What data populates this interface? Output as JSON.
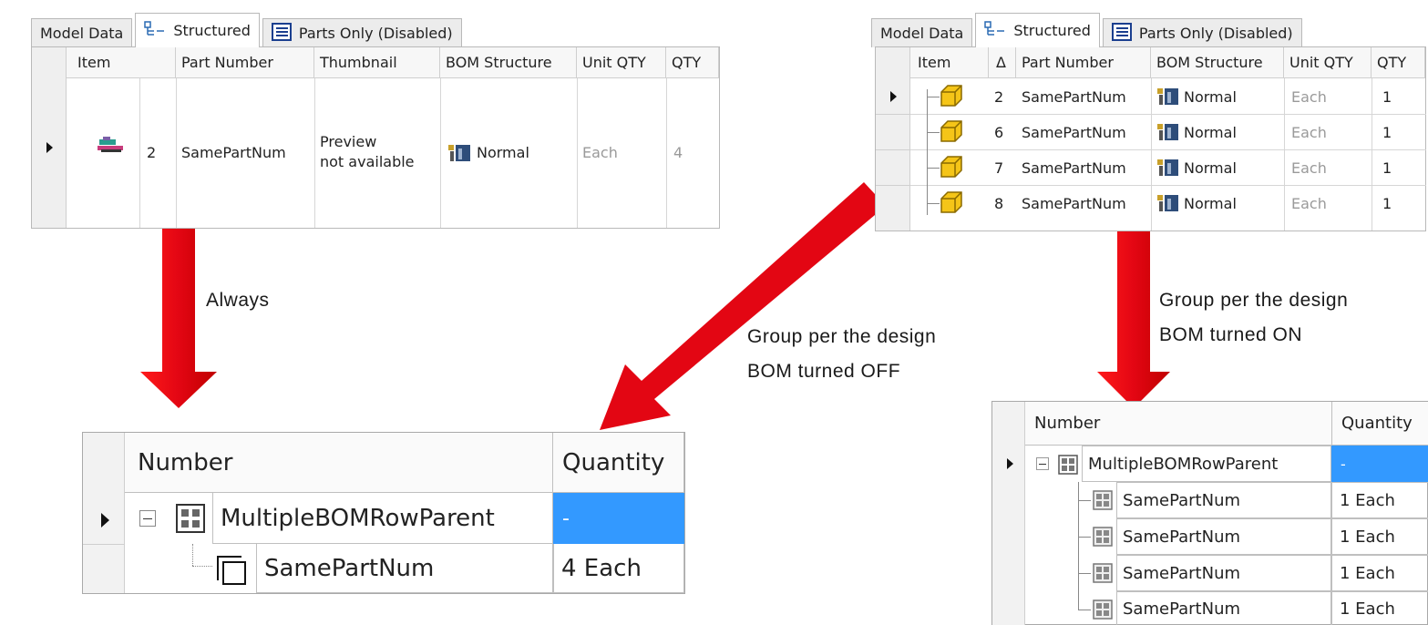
{
  "tabs": {
    "model_data": "Model Data",
    "structured": "Structured",
    "parts_only": "Parts Only (Disabled)"
  },
  "left_grid": {
    "headers": [
      "Item",
      "Part Number",
      "Thumbnail",
      "BOM Structure",
      "Unit QTY",
      "QTY"
    ],
    "row": {
      "item": "2",
      "part_number": "SamePartNum",
      "thumbnail_line1": "Preview",
      "thumbnail_line2": "not available",
      "bom_structure": "Normal",
      "unit_qty": "Each",
      "qty": "4"
    }
  },
  "right_grid": {
    "headers": [
      "Item",
      "Δ",
      "Part Number",
      "BOM Structure",
      "Unit QTY",
      "QTY"
    ],
    "rows": [
      {
        "item": "2",
        "part_number": "SamePartNum",
        "bom_structure": "Normal",
        "unit_qty": "Each",
        "qty": "1"
      },
      {
        "item": "6",
        "part_number": "SamePartNum",
        "bom_structure": "Normal",
        "unit_qty": "Each",
        "qty": "1"
      },
      {
        "item": "7",
        "part_number": "SamePartNum",
        "bom_structure": "Normal",
        "unit_qty": "Each",
        "qty": "1"
      },
      {
        "item": "8",
        "part_number": "SamePartNum",
        "bom_structure": "Normal",
        "unit_qty": "Each",
        "qty": "1"
      }
    ]
  },
  "labels": {
    "always": "Always",
    "off_line1": "Group per the design",
    "off_line2": "BOM turned OFF",
    "on_line1": "Group per the design",
    "on_line2": "BOM turned ON"
  },
  "bom_left": {
    "header_number": "Number",
    "header_quantity": "Quantity",
    "parent": "MultipleBOMRowParent",
    "parent_qty": "-",
    "child": "SamePartNum",
    "child_qty": "4 Each"
  },
  "bom_right": {
    "header_number": "Number",
    "header_quantity": "Quantity",
    "parent": "MultipleBOMRowParent",
    "parent_qty": "-",
    "children": [
      {
        "name": "SamePartNum",
        "qty": "1 Each"
      },
      {
        "name": "SamePartNum",
        "qty": "1 Each"
      },
      {
        "name": "SamePartNum",
        "qty": "1 Each"
      },
      {
        "name": "SamePartNum",
        "qty": "1 Each"
      }
    ]
  },
  "colors": {
    "arrow_red": "#e30613",
    "selection_blue": "#3399ff"
  }
}
